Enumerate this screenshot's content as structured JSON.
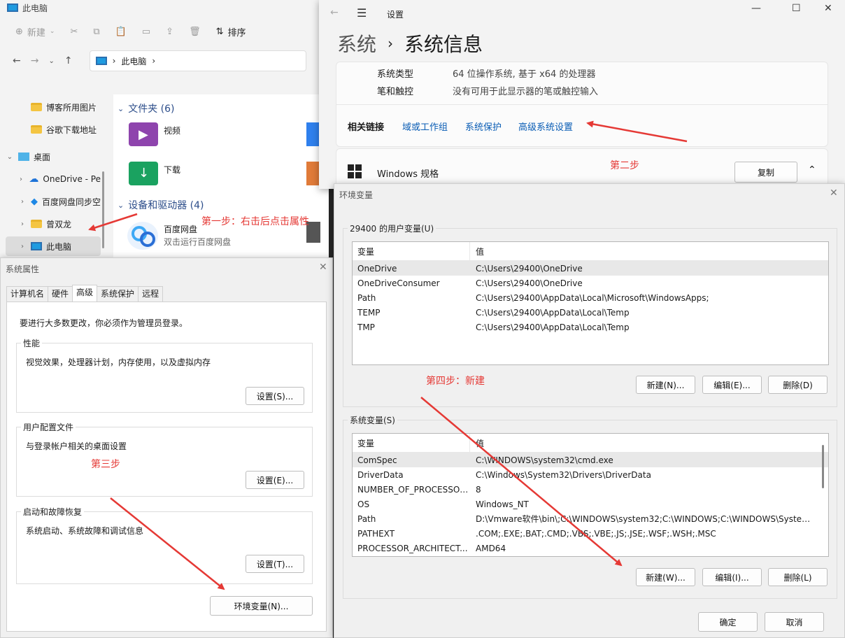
{
  "explorer": {
    "title": "此电脑",
    "toolbar": {
      "new_label": "新建",
      "sort_label": "排序"
    },
    "address": {
      "location": "此电脑"
    },
    "nav": [
      {
        "label": "博客所用图片",
        "icon": "folder-icon"
      },
      {
        "label": "谷歌下载地址",
        "icon": "folder-icon"
      },
      {
        "label": "桌面",
        "icon": "desktop-icon"
      },
      {
        "label": "OneDrive - Pe",
        "icon": "cloud-icon"
      },
      {
        "label": "百度网盘同步空",
        "icon": "baidu-sync-icon"
      },
      {
        "label": "曾双龙",
        "icon": "folder-icon"
      },
      {
        "label": "此电脑",
        "icon": "pc-icon"
      }
    ],
    "sections": {
      "folders": "文件夹 (6)",
      "drives": "设备和驱动器 (4)"
    },
    "items": {
      "videos": "视频",
      "downloads": "下载",
      "baidu_name": "百度网盘",
      "baidu_desc": "双击运行百度网盘"
    }
  },
  "settings": {
    "app_title": "设置",
    "breadcrumb_parent": "系统",
    "breadcrumb_current": "系统信息",
    "system_type_label": "系统类型",
    "system_type_value": "64 位操作系统, 基于 x64 的处理器",
    "pen_label": "笔和触控",
    "pen_value": "没有可用于此显示器的笔或触控输入",
    "related_links_label": "相关链接",
    "links": [
      "域或工作组",
      "系统保护",
      "高级系统设置"
    ],
    "windows_spec_label": "Windows 规格",
    "copy_button": "复制"
  },
  "sysprop": {
    "title": "系统属性",
    "tabs": [
      "计算机名",
      "硬件",
      "高级",
      "系统保护",
      "远程"
    ],
    "admin_note": "要进行大多数更改，你必须作为管理员登录。",
    "perf_group": "性能",
    "perf_desc": "视觉效果，处理器计划，内存使用，以及虚拟内存",
    "perf_button": "设置(S)...",
    "profile_group": "用户配置文件",
    "profile_desc": "与登录帐户相关的桌面设置",
    "profile_button": "设置(E)...",
    "startup_group": "启动和故障恢复",
    "startup_desc": "系统启动、系统故障和调试信息",
    "startup_button": "设置(T)...",
    "env_button": "环境变量(N)..."
  },
  "envvar": {
    "title": "环境变量",
    "user_group": "29400 的用户变量(U)",
    "col_var": "变量",
    "col_val": "值",
    "user_vars": [
      {
        "name": "OneDrive",
        "value": "C:\\Users\\29400\\OneDrive"
      },
      {
        "name": "OneDriveConsumer",
        "value": "C:\\Users\\29400\\OneDrive"
      },
      {
        "name": "Path",
        "value": "C:\\Users\\29400\\AppData\\Local\\Microsoft\\WindowsApps;"
      },
      {
        "name": "TEMP",
        "value": "C:\\Users\\29400\\AppData\\Local\\Temp"
      },
      {
        "name": "TMP",
        "value": "C:\\Users\\29400\\AppData\\Local\\Temp"
      }
    ],
    "user_buttons": [
      "新建(N)...",
      "编辑(E)...",
      "删除(D)"
    ],
    "system_group": "系统变量(S)",
    "system_vars": [
      {
        "name": "ComSpec",
        "value": "C:\\WINDOWS\\system32\\cmd.exe"
      },
      {
        "name": "DriverData",
        "value": "C:\\Windows\\System32\\Drivers\\DriverData"
      },
      {
        "name": "NUMBER_OF_PROCESSORS",
        "value": "8"
      },
      {
        "name": "OS",
        "value": "Windows_NT"
      },
      {
        "name": "Path",
        "value": "D:\\Vmware软件\\bin\\;C:\\WINDOWS\\system32;C:\\WINDOWS;C:\\WINDOWS\\System..."
      },
      {
        "name": "PATHEXT",
        "value": ".COM;.EXE;.BAT;.CMD;.VBS;.VBE;.JS;.JSE;.WSF;.WSH;.MSC"
      },
      {
        "name": "PROCESSOR_ARCHITECT...",
        "value": "AMD64"
      }
    ],
    "system_buttons": [
      "新建(W)...",
      "编辑(I)...",
      "删除(L)"
    ],
    "ok_button": "确定",
    "cancel_button": "取消"
  },
  "annotations": {
    "step1": "第一步：右击后点击属性",
    "step2": "第二步",
    "step3": "第三步",
    "step4": "第四步：新建",
    "color": "#e53935"
  }
}
